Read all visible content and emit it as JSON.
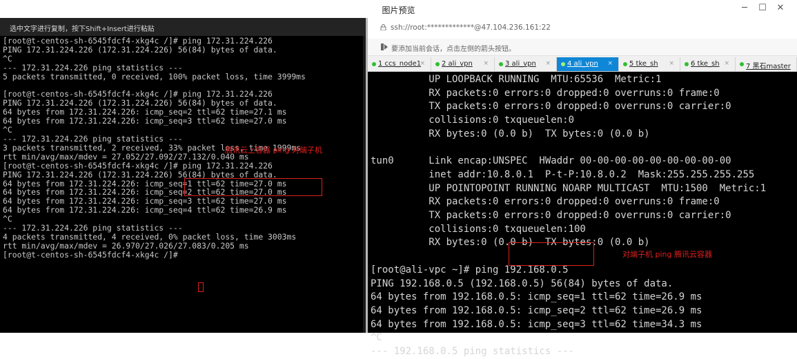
{
  "window": {
    "title": "图片预览",
    "minimize": "─",
    "maximize": "☐",
    "close": "✕"
  },
  "left_terminal": {
    "banner": "选中文字进行复制，按下Shift+Insert进行粘贴",
    "lines": [
      "[root@t-centos-sh-6545fdcf4-xkg4c /]# ping 172.31.224.226",
      "PING 172.31.224.226 (172.31.224.226) 56(84) bytes of data.",
      "^C",
      "--- 172.31.224.226 ping statistics ---",
      "5 packets transmitted, 0 received, 100% packet loss, time 3999ms",
      "",
      "[root@t-centos-sh-6545fdcf4-xkg4c /]# ping 172.31.224.226",
      "PING 172.31.224.226 (172.31.224.226) 56(84) bytes of data.",
      "64 bytes from 172.31.224.226: icmp_seq=2 ttl=62 time=27.1 ms",
      "64 bytes from 172.31.224.226: icmp_seq=3 ttl=62 time=27.0 ms",
      "^C",
      "--- 172.31.224.226 ping statistics ---",
      "3 packets transmitted, 2 received, 33% packet loss, time 1999ms",
      "rtt min/avg/max/mdev = 27.052/27.092/27.132/0.040 ms",
      "[root@t-centos-sh-6545fdcf4-xkg4c /]# ping 172.31.224.226",
      "PING 172.31.224.226 (172.31.224.226) 56(84) bytes of data.",
      "64 bytes from 172.31.224.226: icmp_seq=1 ttl=62 time=27.0 ms",
      "64 bytes from 172.31.224.226: icmp_seq=2 ttl=62 time=27.0 ms",
      "64 bytes from 172.31.224.226: icmp_seq=3 ttl=62 time=27.0 ms",
      "64 bytes from 172.31.224.226: icmp_seq=4 ttl=62 time=26.9 ms",
      "^C",
      "--- 172.31.224.226 ping statistics ---",
      "4 packets transmitted, 4 received, 0% packet loss, time 3003ms",
      "rtt min/avg/max/mdev = 26.970/27.026/27.083/0.205 ms",
      "[root@t-centos-sh-6545fdcf4-xkg4c /]# "
    ],
    "annotation": "腾讯云上容器 ping 对端子机"
  },
  "ssh_client": {
    "address": "ssh://root:*************@47.104.236.161:22",
    "info": "要添加当前会话，点击左侧的箭头按钮。",
    "tabs": [
      {
        "num": "1",
        "name": "ccs_node1"
      },
      {
        "num": "2",
        "name": "ali_vpn"
      },
      {
        "num": "3",
        "name": "ali_vpn"
      },
      {
        "num": "4",
        "name": "ali_vpn"
      },
      {
        "num": "5",
        "name": "tke_sh"
      },
      {
        "num": "6",
        "name": "tke_sh"
      },
      {
        "num": "7",
        "name": "黑石master"
      }
    ],
    "active_tab": 3,
    "tab_close": "×",
    "lines": [
      "          UP LOOPBACK RUNNING  MTU:65536  Metric:1",
      "          RX packets:0 errors:0 dropped:0 overruns:0 frame:0",
      "          TX packets:0 errors:0 dropped:0 overruns:0 carrier:0",
      "          collisions:0 txqueuelen:0",
      "          RX bytes:0 (0.0 b)  TX bytes:0 (0.0 b)",
      "",
      "tun0      Link encap:UNSPEC  HWaddr 00-00-00-00-00-00-00-00-00",
      "          inet addr:10.8.0.1  P-t-P:10.8.0.2  Mask:255.255.255.255",
      "          UP POINTOPOINT RUNNING NOARP MULTICAST  MTU:1500  Metric:1",
      "          RX packets:0 errors:0 dropped:0 overruns:0 frame:0",
      "          TX packets:0 errors:0 dropped:0 overruns:0 carrier:0",
      "          collisions:0 txqueuelen:100",
      "          RX bytes:0 (0.0 b)  TX bytes:0 (0.0 b)",
      "",
      "[root@ali-vpc ~]# ping 192.168.0.5",
      "PING 192.168.0.5 (192.168.0.5) 56(84) bytes of data.",
      "64 bytes from 192.168.0.5: icmp_seq=1 ttl=62 time=26.9 ms",
      "64 bytes from 192.168.0.5: icmp_seq=2 ttl=62 time=26.9 ms",
      "64 bytes from 192.168.0.5: icmp_seq=3 ttl=62 time=34.3 ms",
      "^C",
      "--- 192.168.0.5 ping statistics ---"
    ],
    "annotation": "对端子机 ping 腾讯云容器"
  },
  "colors": {
    "annotation": "#e02020",
    "active_tab": "#0f86d6",
    "tab_dot": "#2fbf30"
  }
}
